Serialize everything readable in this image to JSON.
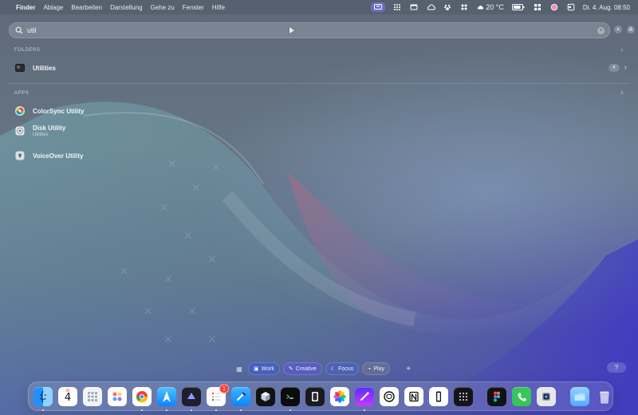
{
  "menubar": {
    "app_name": "Finder",
    "menus": [
      "Ablage",
      "Bearbeiten",
      "Darstellung",
      "Gehe zu",
      "Fenster",
      "Hilfe"
    ],
    "weather": "20 °C",
    "clock": "Di. 4. Aug.  08:50",
    "status_icons": [
      "screen-share-icon",
      "grid-icon",
      "window-icon",
      "cloud-icon",
      "paw-icon",
      "control-center-icon",
      "weather-icon",
      "battery-icon",
      "apps-icon",
      "avatar-icon",
      "switch-icon"
    ]
  },
  "search": {
    "query": "util",
    "placeholder": ""
  },
  "search_right": {
    "button_1": "×",
    "button_2": "A"
  },
  "results": {
    "folders": {
      "header": "FOLDERS",
      "count": "1",
      "items": [
        {
          "title": "Utilities",
          "badge": "4"
        }
      ]
    },
    "apps": {
      "header": "APPS",
      "count": "3",
      "items": [
        {
          "title": "ColorSync Utility",
          "subtitle": ""
        },
        {
          "title": "Disk Utility",
          "subtitle": "Utilities"
        },
        {
          "title": "VoiceOver Utility",
          "subtitle": ""
        }
      ]
    }
  },
  "bottom_bar": {
    "chips": [
      {
        "label": "Work",
        "icon": "briefcase-icon"
      },
      {
        "label": "Creative",
        "icon": "pen-icon"
      },
      {
        "label": "Focus",
        "icon": "moon-icon"
      },
      {
        "label": "Play",
        "icon": "gamepad-icon"
      }
    ],
    "add_label": "+",
    "help_label": "?"
  },
  "dock": {
    "calendar_day": "4",
    "calendar_month": "Di",
    "reminders_badge": "1"
  },
  "colors": {
    "accent": "#3b82f6"
  }
}
